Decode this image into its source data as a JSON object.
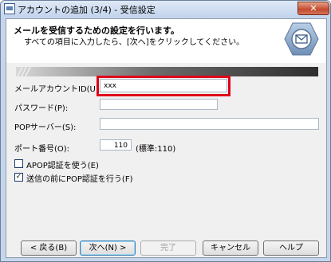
{
  "window": {
    "title": "アカウントの追加 (3/4) - 受信設定",
    "close_glyph": "✕"
  },
  "header": {
    "title": "メールを受信するための設定を行います。",
    "subtitle": "すべての項目に入力したら、[次へ]をクリックしてください。"
  },
  "form": {
    "account_label": "メールアカウントID(U):",
    "account_value": "xxx",
    "password_label": "パスワード(P):",
    "password_value": "",
    "pop_server_label": "POPサーバー(S):",
    "pop_server_value": "",
    "port_label": "ポート番号(O):",
    "port_value": "110",
    "port_hint": "(標準:110)",
    "apop_label": "APOP認証を使う(E)",
    "apop_checked": false,
    "pop_before_send_label": "送信の前にPOP認証を行う(F)",
    "pop_before_send_checked": true,
    "check_glyph": "✓"
  },
  "buttons": {
    "back": "< 戻る(B)",
    "next": "次へ(N) >",
    "finish": "完了",
    "cancel": "キャンセル",
    "help": "ヘルプ"
  },
  "colors": {
    "highlight": "#e0001b",
    "titlebar": "#c3d4ec",
    "banner_dark": "#3a3a3a"
  }
}
